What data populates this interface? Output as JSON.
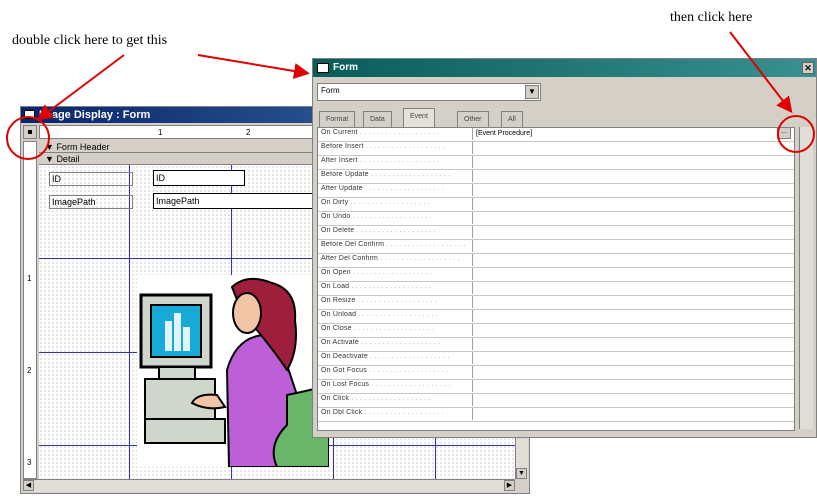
{
  "annotations": {
    "top_left": "double click here to get this",
    "top_right": "then click here"
  },
  "design_window": {
    "title": "Image Display : Form",
    "ruler_marks": [
      "1",
      "2"
    ],
    "vruler_marks": [
      "1",
      "2",
      "3"
    ],
    "sections": {
      "form_header": "Form Header",
      "detail": "Detail"
    },
    "controls": [
      {
        "label": "ID",
        "field": "ID"
      },
      {
        "label": "ImagePath",
        "field": "ImagePath"
      }
    ]
  },
  "property_sheet": {
    "title": "Form",
    "object_selector": "Form",
    "tabs": [
      "Format",
      "Data",
      "Event",
      "Other",
      "All"
    ],
    "active_tab": "Event",
    "properties": [
      {
        "name": "On Current",
        "value": "[Event Procedure]"
      },
      {
        "name": "Before Insert",
        "value": ""
      },
      {
        "name": "After Insert",
        "value": ""
      },
      {
        "name": "Before Update",
        "value": ""
      },
      {
        "name": "After Update",
        "value": ""
      },
      {
        "name": "On Dirty",
        "value": ""
      },
      {
        "name": "On Undo",
        "value": ""
      },
      {
        "name": "On Delete",
        "value": ""
      },
      {
        "name": "Before Del Confirm",
        "value": ""
      },
      {
        "name": "After Del Confirm",
        "value": ""
      },
      {
        "name": "On Open",
        "value": ""
      },
      {
        "name": "On Load",
        "value": ""
      },
      {
        "name": "On Resize",
        "value": ""
      },
      {
        "name": "On Unload",
        "value": ""
      },
      {
        "name": "On Close",
        "value": ""
      },
      {
        "name": "On Activate",
        "value": ""
      },
      {
        "name": "On Deactivate",
        "value": ""
      },
      {
        "name": "On Got Focus",
        "value": ""
      },
      {
        "name": "On Lost Focus",
        "value": ""
      },
      {
        "name": "On Click",
        "value": ""
      },
      {
        "name": "On Dbl Click",
        "value": ""
      }
    ],
    "build_button": "..."
  },
  "colors": {
    "arrow": "#e00000",
    "highlight_circle": "#e00000",
    "grid_lines": "#3030b0"
  }
}
